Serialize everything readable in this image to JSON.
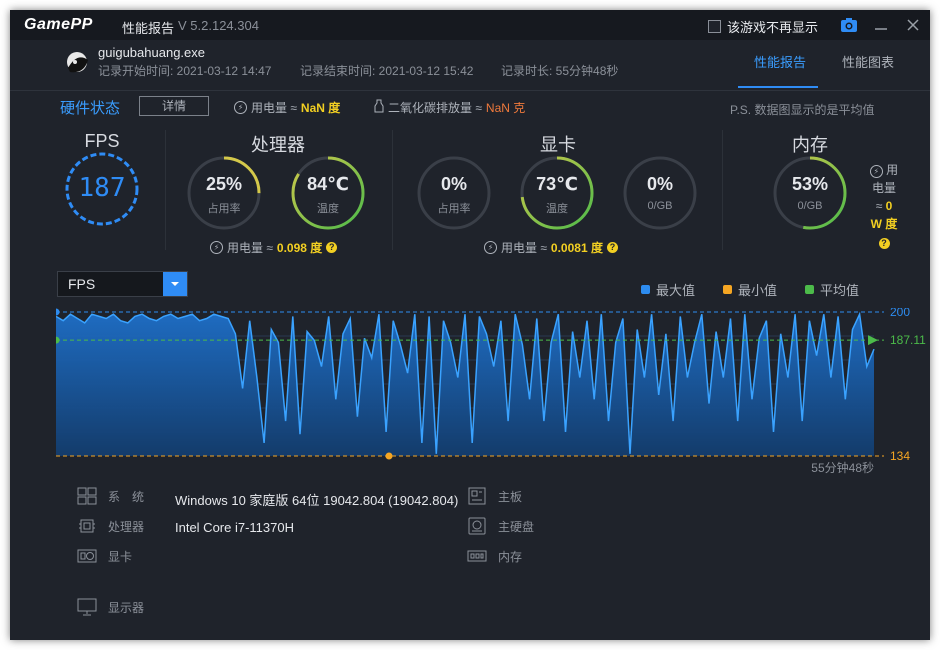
{
  "window": {
    "logo": "GamePP",
    "title": "性能报告",
    "version": "V 5.2.124.304",
    "no_show_label": "该游戏不再显示"
  },
  "header": {
    "exe": "guigubahuang.exe",
    "start": "记录开始时间: 2021-03-12 14:47",
    "end": "记录结束时间: 2021-03-12 15:42",
    "duration": "记录时长: 55分钟48秒",
    "tabs": [
      "性能报告",
      "性能图表"
    ]
  },
  "status": {
    "title": "硬件状态",
    "detail_btn": "详情",
    "power_label": "用电量 ≈",
    "power_value": "NaN 度",
    "co2_label": "二氧化碳排放量 ≈",
    "co2_value": "NaN 克",
    "note": "P.S. 数据图显示的是平均值"
  },
  "fps": {
    "title": "FPS",
    "value": "187"
  },
  "cpu": {
    "title": "处理器",
    "usage": {
      "value": "25%",
      "label": "占用率",
      "fraction": 0.25
    },
    "temp": {
      "value": "84℃",
      "label": "温度",
      "fraction": 0.84
    },
    "power_label": "用电量 ≈",
    "power_value": "0.098 度"
  },
  "gpu": {
    "title": "显卡",
    "usage": {
      "value": "0%",
      "label": "占用率",
      "fraction": 0
    },
    "temp": {
      "value": "73℃",
      "label": "温度",
      "fraction": 0.73
    },
    "vram": {
      "value": "0%",
      "label": "0/GB",
      "fraction": 0
    },
    "power_label": "用电量 ≈",
    "power_value": "0.0081 度"
  },
  "memory": {
    "title": "内存",
    "usage": {
      "value": "53%",
      "label": "0/GB",
      "fraction": 0.53
    },
    "power_label": [
      "用",
      "电量",
      "≈"
    ],
    "power_value": [
      "0",
      "W 度"
    ]
  },
  "chart_controls": {
    "metric": "FPS",
    "legend": [
      {
        "name": "最大值",
        "color": "#2d8cf0"
      },
      {
        "name": "最小值",
        "color": "#f5a623"
      },
      {
        "name": "平均值",
        "color": "#4cbb4a"
      }
    ]
  },
  "chart_data": {
    "type": "area",
    "series": [
      {
        "name": "FPS",
        "values": [
          198,
          196,
          199,
          197,
          195,
          199,
          198,
          197,
          199,
          196,
          195,
          198,
          199,
          197,
          196,
          198,
          199,
          197,
          198,
          199,
          196,
          197,
          199,
          198,
          197,
          190,
          165,
          196,
          170,
          140,
          192,
          186,
          150,
          198,
          144,
          191,
          187,
          175,
          198,
          160,
          190,
          197,
          152,
          188,
          179,
          199,
          145,
          196,
          185,
          172,
          199,
          140,
          198,
          135,
          196,
          186,
          170,
          199,
          140,
          198,
          190,
          175,
          196,
          150,
          199,
          185,
          160,
          197,
          150,
          186,
          199,
          145,
          191,
          170,
          196,
          160,
          199,
          150,
          186,
          197,
          135,
          192,
          170,
          199,
          162,
          190,
          150,
          198,
          170,
          186,
          199,
          158,
          191,
          170,
          197,
          150,
          199,
          160,
          188,
          196,
          145,
          190,
          170,
          199,
          150,
          196,
          180,
          199,
          170,
          198,
          160,
          192,
          199,
          175,
          183
        ]
      }
    ],
    "ylim": [
      134,
      200
    ],
    "ref_lines": [
      {
        "label": "200",
        "value": 200,
        "color": "#2d8cf0"
      },
      {
        "label": "187.11",
        "value": 187.11,
        "color": "#4cbb4a"
      },
      {
        "label": "134",
        "value": 134,
        "color": "#f5a623"
      }
    ],
    "duration_label": "55分钟48秒"
  },
  "system": {
    "rows": [
      {
        "label": "系　统",
        "value": "Windows 10 家庭版 64位   19042.804 (19042.804)",
        "icon": "windows-icon"
      },
      {
        "label": "处理器",
        "value": "Intel Core i7-11370H",
        "icon": "cpu-icon"
      },
      {
        "label": "显卡",
        "value": "",
        "icon": "gpu-icon"
      },
      {
        "label": "显示器",
        "value": "",
        "icon": "monitor-icon"
      }
    ],
    "right_rows": [
      {
        "label": "主板",
        "icon": "motherboard-icon"
      },
      {
        "label": "主硬盘",
        "icon": "disk-icon"
      },
      {
        "label": "内存",
        "icon": "ram-icon"
      }
    ]
  }
}
